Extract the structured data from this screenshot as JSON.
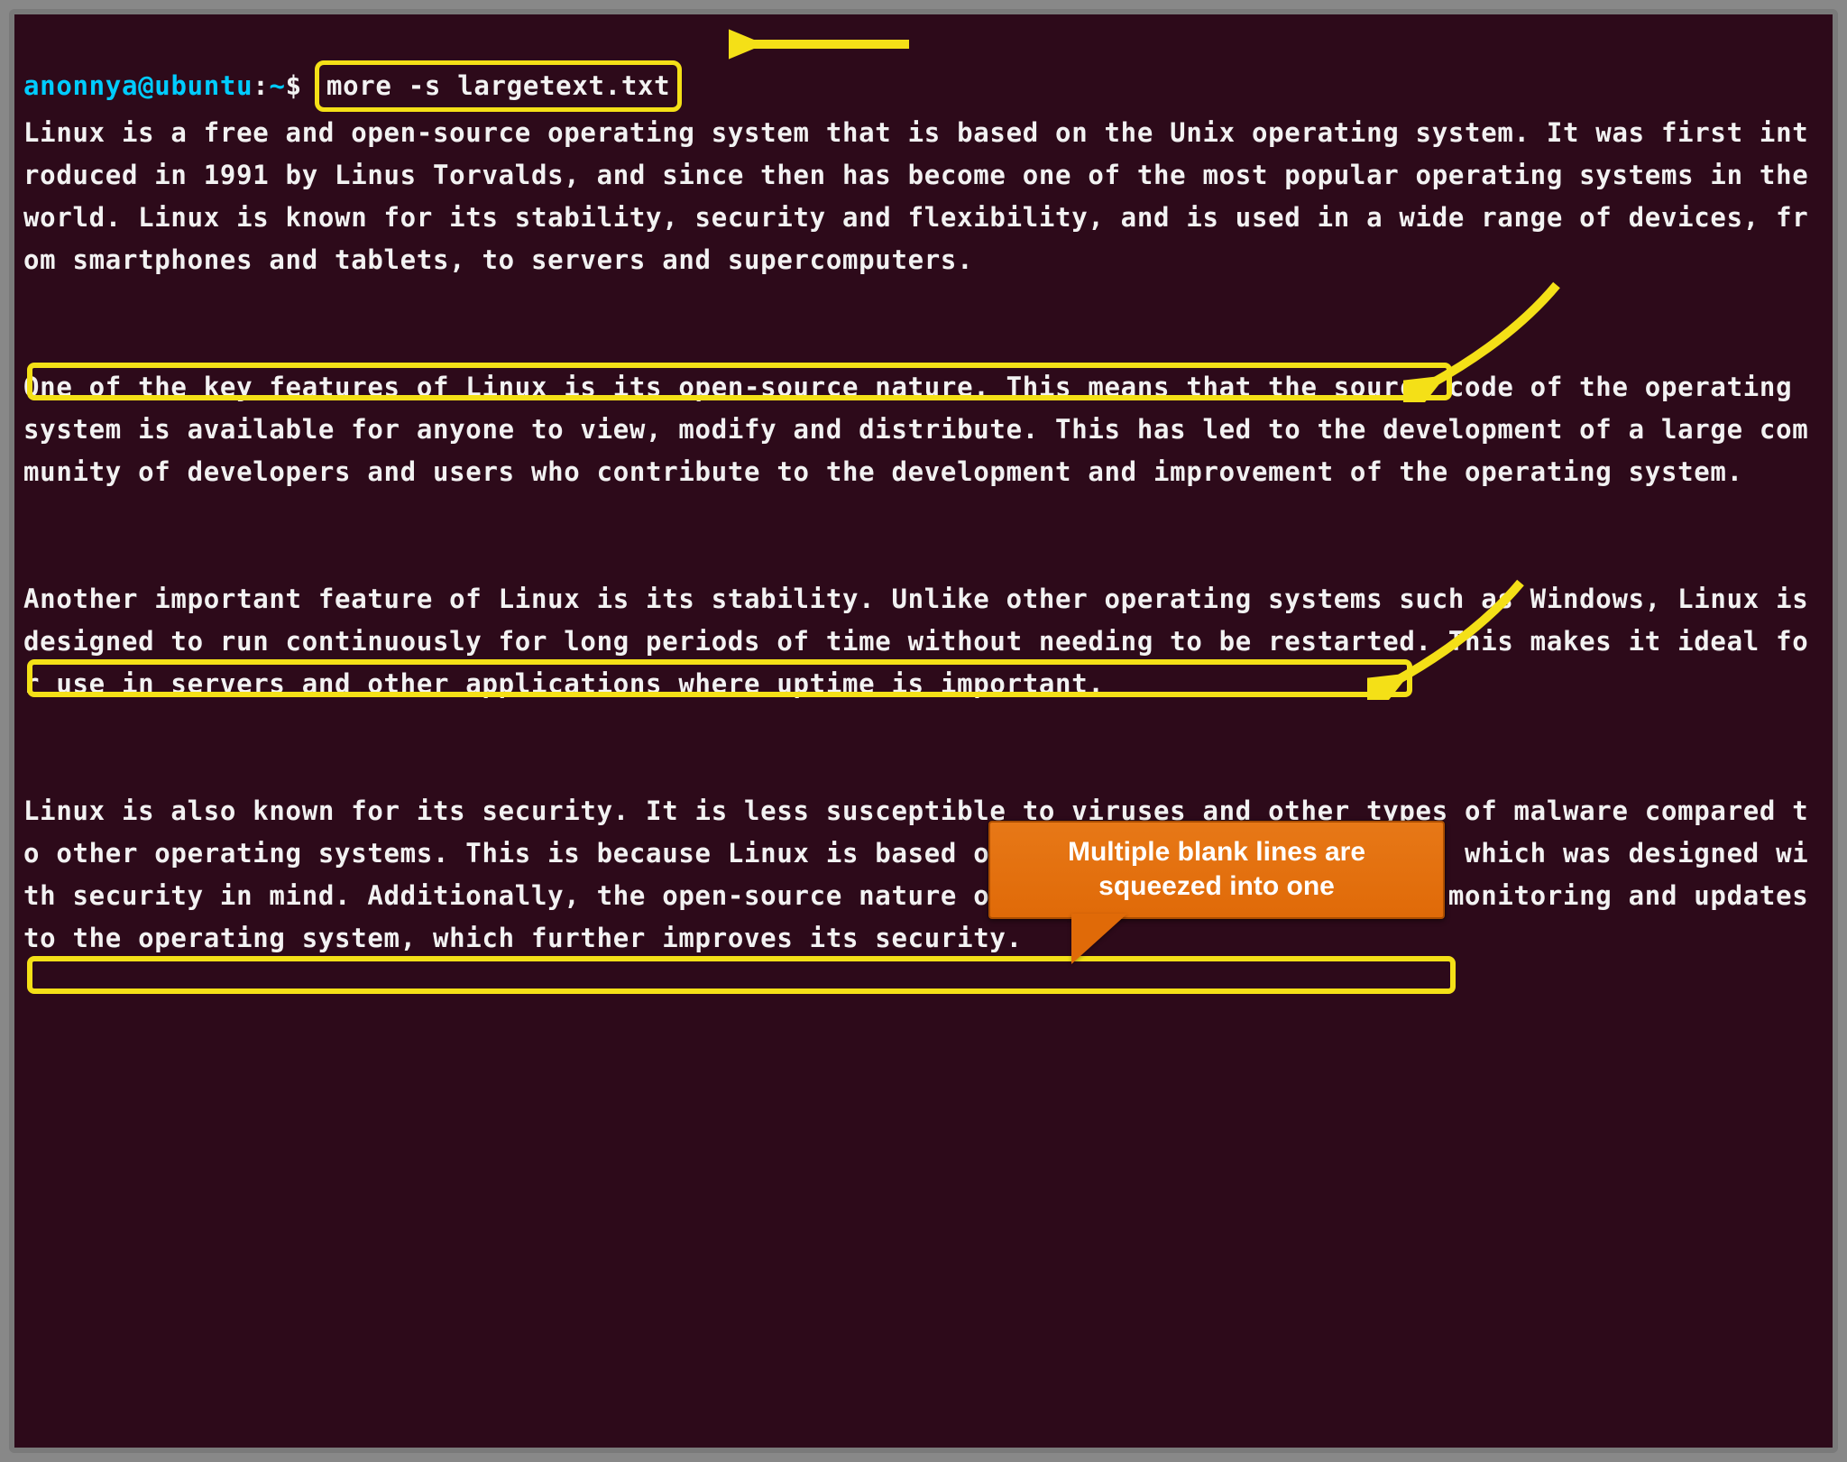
{
  "prompt": {
    "user": "anonnya",
    "at": "@",
    "host": "ubuntu",
    "sep": ":",
    "path": "~",
    "dollar": "$",
    "command": "more -s largetext.txt"
  },
  "paragraphs": {
    "p1": "Linux is a free and open-source operating system that is based on the Unix operating system. It was first introduced in 1991 by Linus Torvalds, and since then has become one of the most popular operating systems in the world. Linux is known for its stability, security and flexibility, and is used in a wide range of devices, from smartphones and tablets, to servers and supercomputers.",
    "p2": "One of the key features of Linux is its open-source nature. This means that the source code of the operating system is available for anyone to view, modify and distribute. This has led to the development of a large community of developers and users who contribute to the development and improvement of the operating system.",
    "p3": "Another important feature of Linux is its stability. Unlike other operating systems such as Windows, Linux is designed to run continuously for long periods of time without needing to be restarted. This makes it ideal for use in servers and other applications where uptime is important.",
    "p4": "Linux is also known for its security. It is less susceptible to viruses and other types of malware compared to other operating systems. This is because Linux is based on the Unix operating system, which was designed with security in mind. Additionally, the open-source nature of Linux allows for constant monitoring and updates to the operating system, which further improves its security."
  },
  "callout_text_line1": "Multiple blank lines are",
  "callout_text_line2": "squeezed into one",
  "colors": {
    "background": "#2d0a1a",
    "text": "#f2f2f2",
    "prompt": "#00ccff",
    "highlight": "#f4e017",
    "callout_bg": "#e77817",
    "callout_text": "#ffffff"
  },
  "annotations": {
    "arrow_to_command": "arrow-left-icon",
    "arrow_to_blank1": "arrow-down-left-icon",
    "arrow_to_blank2": "arrow-down-left-icon",
    "blank_line_highlight": "highlight-box"
  }
}
